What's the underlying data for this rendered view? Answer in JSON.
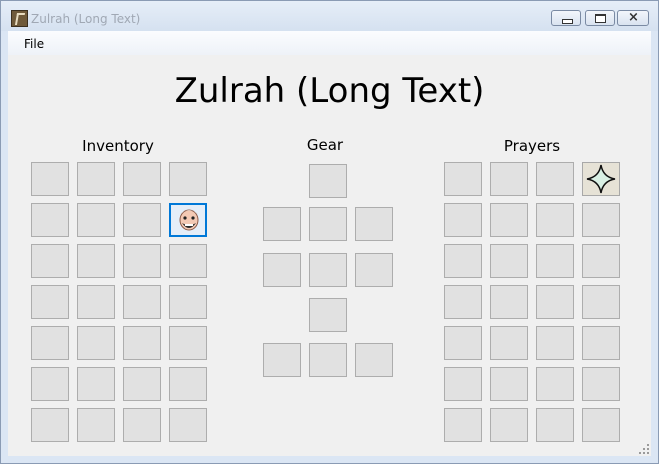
{
  "window": {
    "title": "Zulrah (Long Text)",
    "icon": "app-icon",
    "controls": {
      "minimize": "minimize-icon",
      "maximize": "maximize-icon",
      "close": "×"
    }
  },
  "menu": {
    "file_label": "File"
  },
  "main": {
    "title": "Zulrah (Long Text)"
  },
  "inventory": {
    "title": "Inventory",
    "rows": 7,
    "cols": 4,
    "items": [
      {
        "row": 2,
        "col": 4,
        "icon": "character-face-icon",
        "selected": true
      }
    ]
  },
  "gear": {
    "title": "Gear"
  },
  "prayers": {
    "title": "Prayers",
    "rows": 7,
    "cols": 4,
    "active": [
      {
        "row": 1,
        "col": 4,
        "icon": "four-point-star-icon"
      }
    ]
  },
  "colors": {
    "accent": "#0078d7",
    "slot_bg": "#e1e1e1",
    "slot_border": "#adadad"
  }
}
